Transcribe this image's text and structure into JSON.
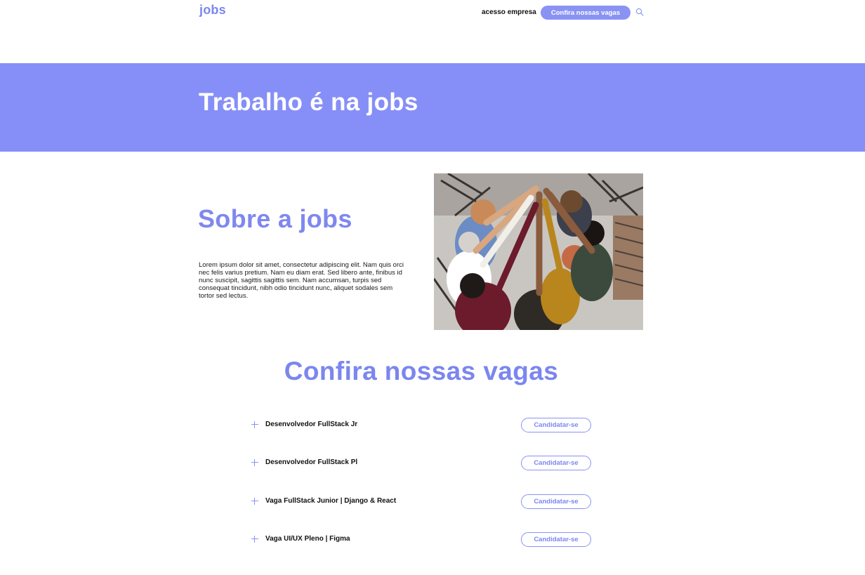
{
  "header": {
    "logo": "jobs",
    "company_link": "acesso empresa",
    "cta_button": "Confira nossas vagas",
    "search_icon": "search-icon"
  },
  "hero": {
    "title": "Trabalho é na jobs"
  },
  "about": {
    "title": "Sobre a jobs",
    "text": "Lorem ipsum dolor sit amet, consectetur adipiscing elit. Nam quis orci nec felis varius pretium. Nam eu diam erat. Sed libero ante, finibus id nunc suscipit, sagittis sagittis sem. Nam accumsan, turpis sed consequat tincidunt, nibh odio tincidunt nunc, aliquet sodales sem tortor sed lectus."
  },
  "jobs": {
    "title": "Confira nossas vagas",
    "items": [
      {
        "title": "Desenvolvedor FullStack Jr",
        "apply_label": "Candidatar-se"
      },
      {
        "title": "Desenvolvedor FullStack Pl",
        "apply_label": "Candidatar-se"
      },
      {
        "title": "Vaga FullStack Junior | Django & React",
        "apply_label": "Candidatar-se"
      },
      {
        "title": "Vaga UI/UX Pleno | Figma",
        "apply_label": "Candidatar-se"
      }
    ]
  },
  "colors": {
    "accent": "#868ff7",
    "accent_text": "#7b86ef"
  }
}
